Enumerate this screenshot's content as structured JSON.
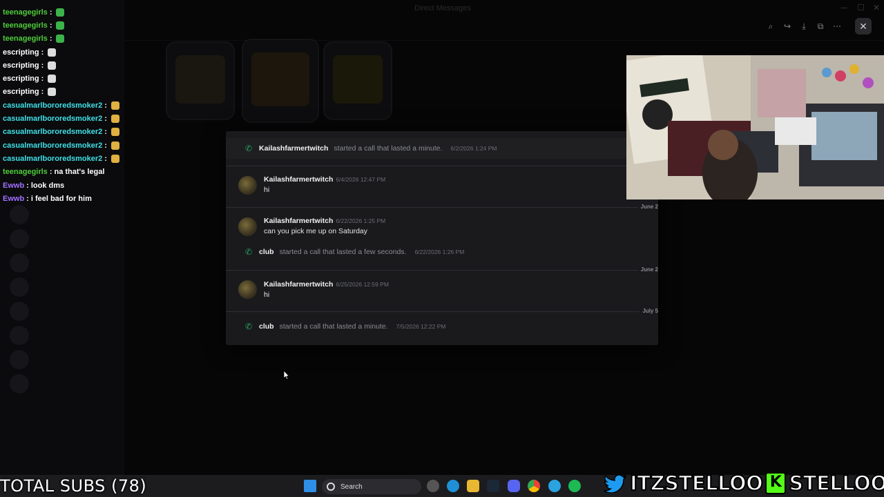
{
  "window": {
    "title": "Direct Messages"
  },
  "chat_overlay": [
    {
      "user": "teenagegirls",
      "color": "#4ecd3a",
      "msg": "",
      "emote": "green"
    },
    {
      "user": "teenagegirls",
      "color": "#4ecd3a",
      "msg": "",
      "emote": "green"
    },
    {
      "user": "teenagegirls",
      "color": "#4ecd3a",
      "msg": "",
      "emote": "green"
    },
    {
      "user": "escripting",
      "color": "#ffffff",
      "msg": "",
      "emote": "skull"
    },
    {
      "user": "escripting",
      "color": "#ffffff",
      "msg": "",
      "emote": "skull"
    },
    {
      "user": "escripting",
      "color": "#ffffff",
      "msg": "",
      "emote": "skull"
    },
    {
      "user": "escripting",
      "color": "#ffffff",
      "msg": "",
      "emote": "skull"
    },
    {
      "user": "casualmarlbororedsmoker2",
      "color": "#3ee0e6",
      "msg": "",
      "emote": "face"
    },
    {
      "user": "casualmarlbororedsmoker2",
      "color": "#3ee0e6",
      "msg": "",
      "emote": "face"
    },
    {
      "user": "casualmarlbororedsmoker2",
      "color": "#3ee0e6",
      "msg": "",
      "emote": "face"
    },
    {
      "user": "casualmarlbororedsmoker2",
      "color": "#3ee0e6",
      "msg": "",
      "emote": "face"
    },
    {
      "user": "casualmarlbororedsmoker2",
      "color": "#3ee0e6",
      "msg": "",
      "emote": "face"
    },
    {
      "user": "teenagegirls",
      "color": "#4ecd3a",
      "msg": "na that's legal",
      "emote": ""
    },
    {
      "user": "Ewwb",
      "color": "#a070ff",
      "msg": "look dms",
      "emote": ""
    },
    {
      "user": "Ewwb",
      "color": "#a070ff",
      "msg": "i feel bad for him",
      "emote": ""
    }
  ],
  "popup": {
    "first_call": {
      "user": "Kailashfarmertwitch",
      "text": "started a call that lasted a minute.",
      "ts": "6/2/2026 1:24 PM"
    },
    "msg1": {
      "user": "Kailashfarmertwitch",
      "ts": "6/4/2026 12:47 PM",
      "body": "hi"
    },
    "divider1": "June 2",
    "msg2": {
      "user": "Kailashfarmertwitch",
      "ts": "6/22/2026 1:25 PM",
      "body": "can you pick me up on Saturday"
    },
    "call2": {
      "user": "club",
      "text": "started a call that lasted a few seconds.",
      "ts": "6/22/2026 1:26 PM"
    },
    "divider2": "June 2",
    "msg3": {
      "user": "Kailashfarmertwitch",
      "ts": "6/25/2026 12:59 PM",
      "body": "hi"
    },
    "divider3": "July 5",
    "call3": {
      "user": "club",
      "text": "started a call that lasted a minute.",
      "ts": "7/5/2026 12:22 PM"
    }
  },
  "taskbar": {
    "search_label": "Search"
  },
  "stream": {
    "subs": "TOTAL SUBS (78)",
    "twitter": "ITZSTELLOO",
    "kick_letter": "K",
    "kick": "STELLOOO"
  },
  "colors": {
    "accent_green": "#23a55a",
    "kick": "#53fc18",
    "twitter": "#1d9bf0"
  }
}
